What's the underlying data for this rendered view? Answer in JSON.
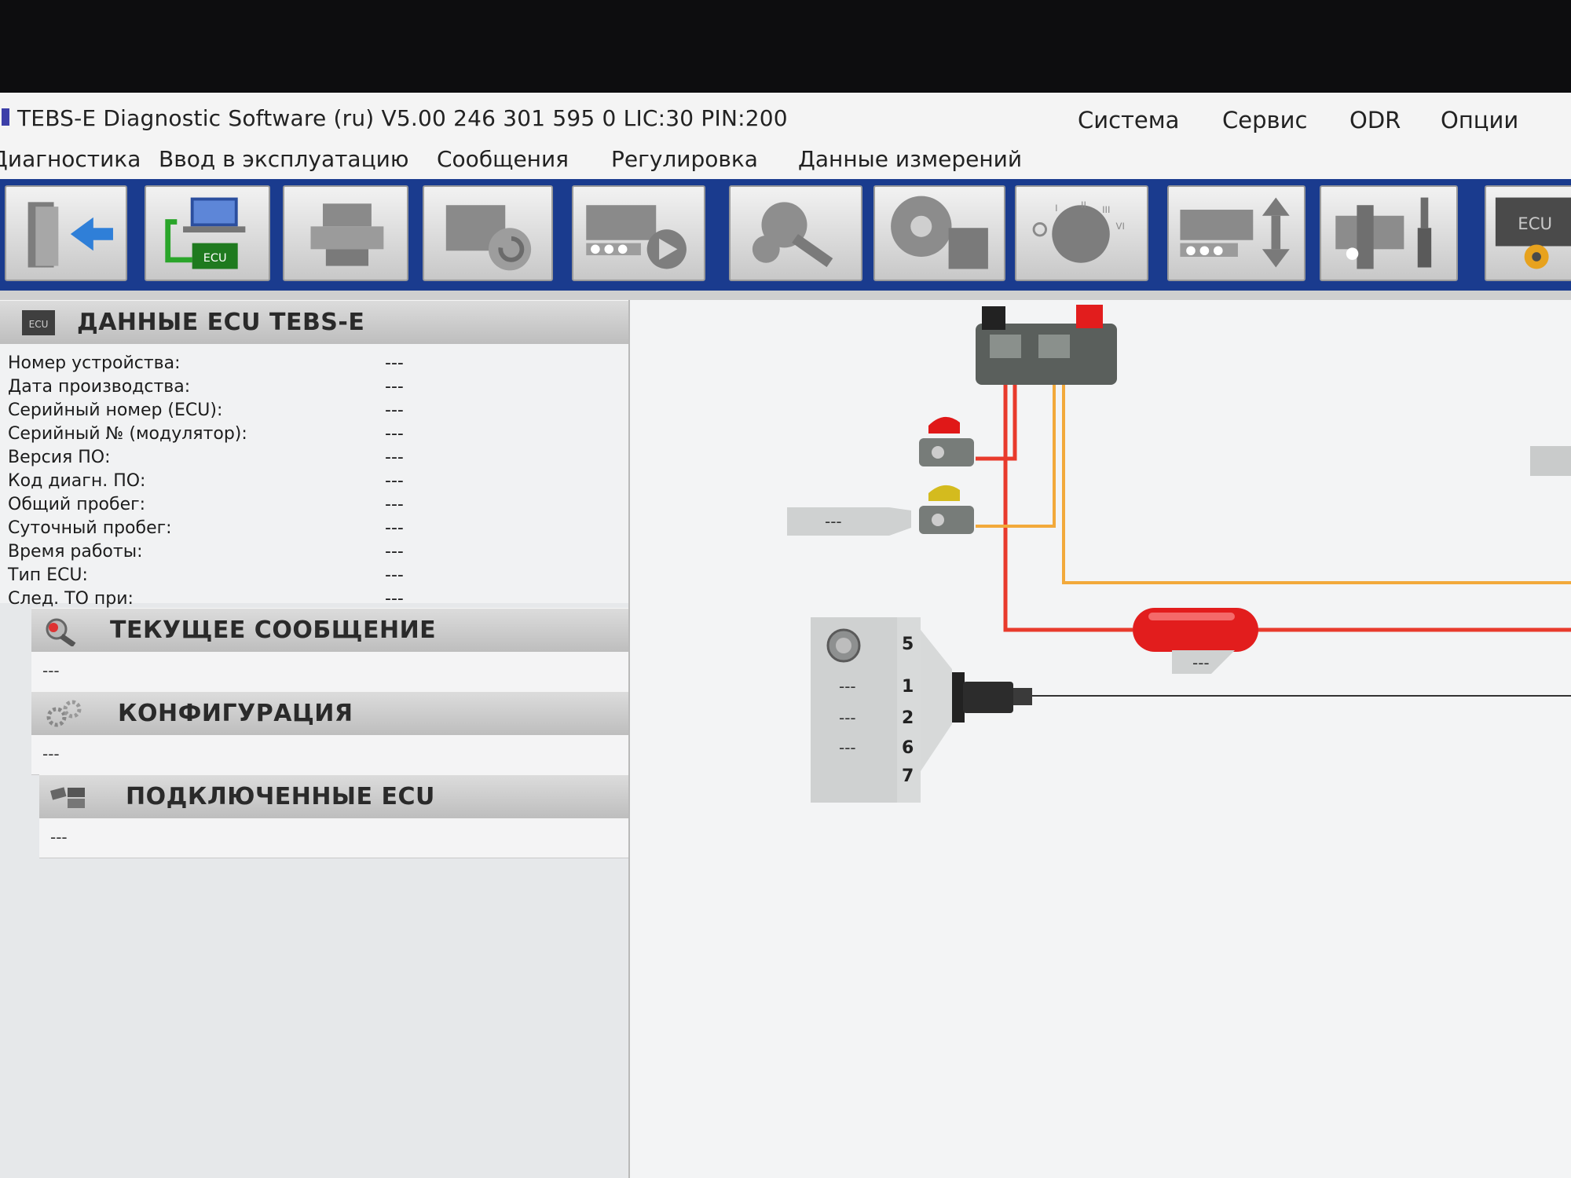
{
  "window": {
    "title": "TEBS-E Diagnostic Software (ru) V5.00  246 301 595 0  LIC:30 PIN:200"
  },
  "menu_top": [
    "Система",
    "Сервис",
    "ODR",
    "Опции"
  ],
  "menu_main": [
    "Диагностика",
    "Ввод в эксплуатацию",
    "Сообщения",
    "Регулировка",
    "Данные измерений"
  ],
  "toolbar": {
    "buttons": [
      "exit-icon",
      "ecu-connect-icon",
      "print-icon",
      "reset-icon",
      "drive-test-icon",
      "search-icon",
      "disk-icon",
      "modulator-icon",
      "lift-axle-icon",
      "service-tools-icon",
      "ecu-settings-icon"
    ],
    "ecu_badge": "ECU"
  },
  "ecu_data": {
    "header": "ДАННЫЕ ECU TEBS-E",
    "icon_text": "ECU",
    "fields": [
      {
        "label": "Номер устройства:",
        "value": "---"
      },
      {
        "label": "Дата производства:",
        "value": "---"
      },
      {
        "label": "Серийный номер (ECU):",
        "value": "---"
      },
      {
        "label": "Серийный № (модулятор):",
        "value": "---"
      },
      {
        "label": "Версия ПО:",
        "value": "---"
      },
      {
        "label": "Код диагн. ПО:",
        "value": "---"
      },
      {
        "label": "Общий пробег:",
        "value": "---"
      },
      {
        "label": "Суточный пробег:",
        "value": "---"
      },
      {
        "label": "Время работы:",
        "value": "---"
      },
      {
        "label": "Тип ECU:",
        "value": "---"
      },
      {
        "label": "След. ТО при:",
        "value": "---"
      }
    ]
  },
  "current_message": {
    "header": "ТЕКУЩЕЕ СООБЩЕНИЕ",
    "value": "---"
  },
  "configuration": {
    "header": "КОНФИГУРАЦИЯ",
    "value": "---"
  },
  "connected_ecu": {
    "header": "ПОДКЛЮЧЕННЫЕ ECU",
    "value": "---"
  },
  "diagram": {
    "sensor_value": "---",
    "tank_value": "---",
    "plug_rows": [
      {
        "pin": "5",
        "value": ""
      },
      {
        "pin": "1",
        "value": "---"
      },
      {
        "pin": "2",
        "value": "---"
      },
      {
        "pin": "6",
        "value": "---"
      },
      {
        "pin": "7",
        "value": ""
      }
    ],
    "colors": {
      "supply_line": "#e83a2c",
      "control_line": "#f2a93b",
      "tank": "#e21d1d",
      "toolbar": "#1a3b8e"
    }
  }
}
